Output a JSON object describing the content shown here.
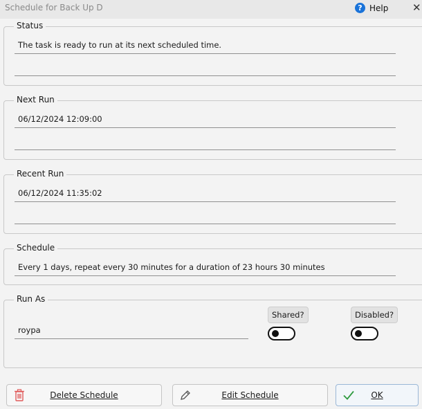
{
  "window": {
    "title": "Schedule for Back Up D",
    "help_label": "Help",
    "close_glyph": "✕"
  },
  "status": {
    "legend": "Status",
    "value": "The task is ready to run at its next scheduled time."
  },
  "next_run": {
    "legend": "Next Run",
    "value": "06/12/2024 12:09:00"
  },
  "recent_run": {
    "legend": "Recent Run",
    "value": "06/12/2024 11:35:02"
  },
  "schedule": {
    "legend": "Schedule",
    "value": "Every 1 days, repeat every 30 minutes for a duration of 23 hours 30 minutes"
  },
  "run_as": {
    "legend": "Run As",
    "user": "roypa",
    "shared_label": "Shared?",
    "shared_on": false,
    "disabled_label": "Disabled?",
    "disabled_on": false
  },
  "buttons": {
    "delete": "Delete Schedule",
    "edit": "Edit Schedule",
    "ok": "OK"
  },
  "colors": {
    "help_icon": "#1a73d9",
    "delete_icon": "#e05a5a",
    "ok_check": "#2e9a3e"
  }
}
